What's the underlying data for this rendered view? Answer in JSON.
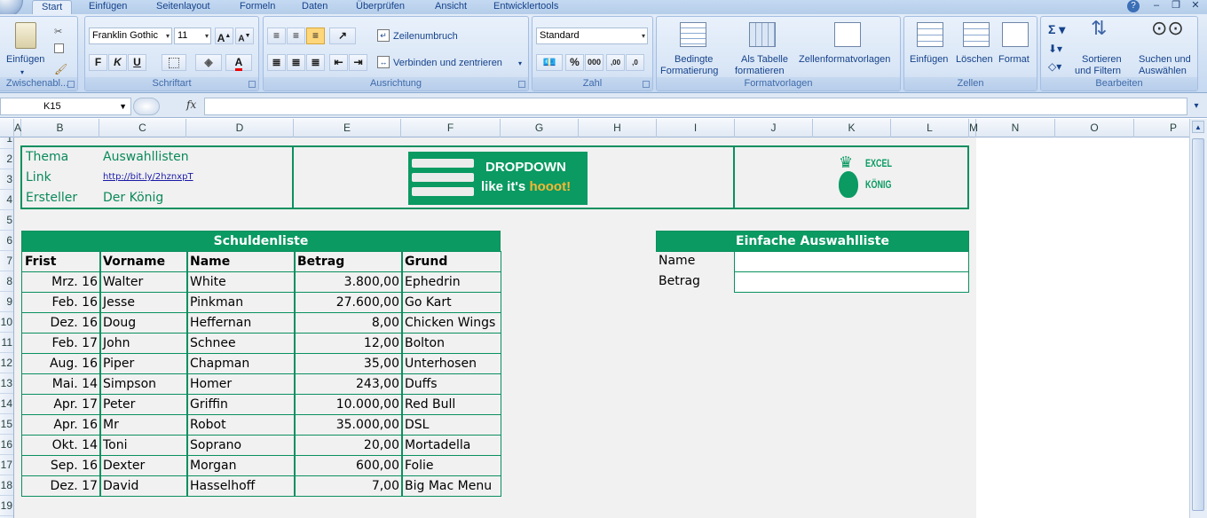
{
  "tabs": [
    "Start",
    "Einfügen",
    "Seitenlayout",
    "Formeln",
    "Daten",
    "Überprüfen",
    "Ansicht",
    "Entwicklertools"
  ],
  "ribbon": {
    "clipboard": {
      "paste": "Einfügen",
      "label": "Zwischenabl..."
    },
    "font": {
      "name": "Franklin Gothic",
      "size": "11",
      "bold": "F",
      "italic": "K",
      "underline": "U",
      "label": "Schriftart"
    },
    "alignment": {
      "wrap": "Zeilenumbruch",
      "merge": "Verbinden und zentrieren",
      "label": "Ausrichtung"
    },
    "number": {
      "format": "Standard",
      "percent": "%",
      "thousands": "000",
      "inc": ",00",
      "dec": ",0",
      "label": "Zahl"
    },
    "styles": {
      "cond1": "Bedingte",
      "cond2": "Formatierung",
      "table1": "Als Tabelle",
      "table2": "formatieren",
      "cellstyles": "Zellenformatvorlagen",
      "label": "Formatvorlagen"
    },
    "cells": {
      "insert": "Einfügen",
      "delete": "Löschen",
      "format": "Format",
      "label": "Zellen"
    },
    "editing": {
      "sort1": "Sortieren",
      "sort2": "und Filtern",
      "find1": "Suchen und",
      "find2": "Auswählen",
      "label": "Bearbeiten"
    }
  },
  "formula_bar": {
    "namebox": "K15",
    "fx": "fx",
    "content": ""
  },
  "columns": [
    "A",
    "B",
    "C",
    "D",
    "E",
    "F",
    "G",
    "H",
    "I",
    "J",
    "K",
    "L",
    "M",
    "N",
    "O",
    "P"
  ],
  "rows": [
    "1",
    "2",
    "3",
    "4",
    "5",
    "6",
    "7",
    "8",
    "9",
    "10",
    "11",
    "12",
    "13",
    "14",
    "15",
    "16",
    "17",
    "18",
    "19"
  ],
  "info": {
    "thema_label": "Thema",
    "thema_value": "Auswahllisten",
    "link_label": "Link",
    "link_value": "http://bit.ly/2hznxpT",
    "ersteller_label": "Ersteller",
    "ersteller_value": "Der König"
  },
  "banner": {
    "line1": "DROPDOWN",
    "line2a": "like it's ",
    "line2b": "hooot!"
  },
  "logo": {
    "line1": "EXCEL",
    "line2": "KÖNIG"
  },
  "debt_table": {
    "title": "Schuldenliste",
    "headers": [
      "Frist",
      "Vorname",
      "Name",
      "Betrag",
      "Grund"
    ],
    "rows": [
      [
        "Mrz. 16",
        "Walter",
        "White",
        "3.800,00",
        "Ephedrin"
      ],
      [
        "Feb. 16",
        "Jesse",
        "Pinkman",
        "27.600,00",
        "Go Kart"
      ],
      [
        "Dez. 16",
        "Doug",
        "Heffernan",
        "8,00",
        "Chicken Wings"
      ],
      [
        "Feb. 17",
        "John",
        "Schnee",
        "12,00",
        "Bolton"
      ],
      [
        "Aug. 16",
        "Piper",
        "Chapman",
        "35,00",
        "Unterhosen"
      ],
      [
        "Mai. 14",
        "Simpson",
        "Homer",
        "243,00",
        "Duffs"
      ],
      [
        "Apr. 17",
        "Peter",
        "Griffin",
        "10.000,00",
        "Red Bull"
      ],
      [
        "Apr. 16",
        "Mr",
        "Robot",
        "35.000,00",
        "DSL"
      ],
      [
        "Okt. 14",
        "Toni",
        "Soprano",
        "20,00",
        "Mortadella"
      ],
      [
        "Sep. 16",
        "Dexter",
        "Morgan",
        "600,00",
        "Folie"
      ],
      [
        "Dez. 17",
        "David",
        "Hasselhoff",
        "7,00",
        "Big Mac Menu"
      ]
    ]
  },
  "select_list": {
    "title": "Einfache Auswahlliste",
    "name_label": "Name",
    "name_value": "",
    "betrag_label": "Betrag",
    "betrag_value": ""
  },
  "colors": {
    "accent": "#0a9a62",
    "ribbon": "#d2e1f4"
  }
}
